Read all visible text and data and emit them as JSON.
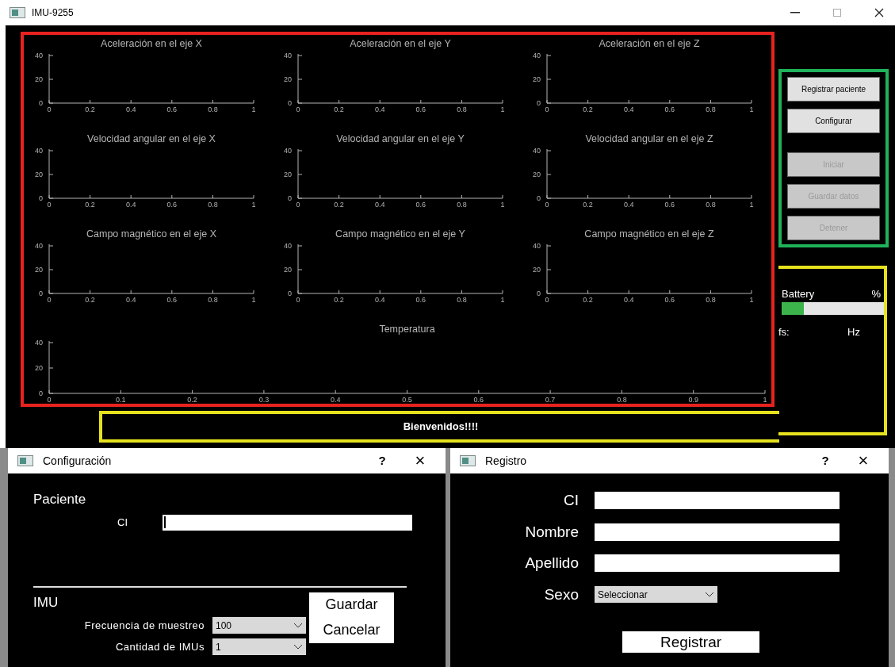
{
  "window": {
    "title": "IMU-9255"
  },
  "charts": [
    {
      "chart_data": {
        "type": "line",
        "title": "Aceleración en el eje X",
        "xlim": [
          0,
          1
        ],
        "ylim": [
          0,
          40
        ],
        "xticks": [
          0,
          0.2,
          0.4,
          0.6,
          0.8,
          1
        ],
        "yticks": [
          0,
          20,
          40
        ]
      }
    },
    {
      "chart_data": {
        "type": "line",
        "title": "Aceleración en el eje Y",
        "xlim": [
          0,
          1
        ],
        "ylim": [
          0,
          40
        ],
        "xticks": [
          0,
          0.2,
          0.4,
          0.6,
          0.8,
          1
        ],
        "yticks": [
          0,
          20,
          40
        ]
      }
    },
    {
      "chart_data": {
        "type": "line",
        "title": "Aceleración en el eje Z",
        "xlim": [
          0,
          1
        ],
        "ylim": [
          0,
          40
        ],
        "xticks": [
          0,
          0.2,
          0.4,
          0.6,
          0.8,
          1
        ],
        "yticks": [
          0,
          20,
          40
        ]
      }
    },
    {
      "chart_data": {
        "type": "line",
        "title": "Velocidad angular en el eje X",
        "xlim": [
          0,
          1
        ],
        "ylim": [
          0,
          40
        ],
        "xticks": [
          0,
          0.2,
          0.4,
          0.6,
          0.8,
          1
        ],
        "yticks": [
          0,
          20,
          40
        ]
      }
    },
    {
      "chart_data": {
        "type": "line",
        "title": "Velocidad angular en el eje Y",
        "xlim": [
          0,
          1
        ],
        "ylim": [
          0,
          40
        ],
        "xticks": [
          0,
          0.2,
          0.4,
          0.6,
          0.8,
          1
        ],
        "yticks": [
          0,
          20,
          40
        ]
      }
    },
    {
      "chart_data": {
        "type": "line",
        "title": "Velocidad angular en el eje Z",
        "xlim": [
          0,
          1
        ],
        "ylim": [
          0,
          40
        ],
        "xticks": [
          0,
          0.2,
          0.4,
          0.6,
          0.8,
          1
        ],
        "yticks": [
          0,
          20,
          40
        ]
      }
    },
    {
      "chart_data": {
        "type": "line",
        "title": "Campo magnético en el eje X",
        "xlim": [
          0,
          1
        ],
        "ylim": [
          0,
          40
        ],
        "xticks": [
          0,
          0.2,
          0.4,
          0.6,
          0.8,
          1
        ],
        "yticks": [
          0,
          20,
          40
        ]
      }
    },
    {
      "chart_data": {
        "type": "line",
        "title": "Campo magnético en el eje Y",
        "xlim": [
          0,
          1
        ],
        "ylim": [
          0,
          40
        ],
        "xticks": [
          0,
          0.2,
          0.4,
          0.6,
          0.8,
          1
        ],
        "yticks": [
          0,
          20,
          40
        ]
      }
    },
    {
      "chart_data": {
        "type": "line",
        "title": "Campo magnético en el eje Z",
        "xlim": [
          0,
          1
        ],
        "ylim": [
          0,
          40
        ],
        "xticks": [
          0,
          0.2,
          0.4,
          0.6,
          0.8,
          1
        ],
        "yticks": [
          0,
          20,
          40
        ]
      }
    },
    {
      "chart_data": {
        "type": "line",
        "title": "Temperatura",
        "xlim": [
          0,
          1
        ],
        "ylim": [
          0,
          40
        ],
        "xticks": [
          0,
          0.1,
          0.2,
          0.3,
          0.4,
          0.5,
          0.6,
          0.7,
          0.8,
          0.9,
          1
        ],
        "yticks": [
          0,
          20,
          40
        ]
      }
    }
  ],
  "controls": [
    {
      "label": "Registrar paciente",
      "disabled": false
    },
    {
      "label": "Configurar",
      "disabled": false
    },
    {
      "label": "Iniciar",
      "disabled": true
    },
    {
      "label": "Guardar datos",
      "disabled": true
    },
    {
      "label": "Detener",
      "disabled": true
    }
  ],
  "status": {
    "battery_label": "Battery",
    "battery_unit": "%",
    "battery": {
      "level": 0.22
    },
    "fs_label": "fs:",
    "fs_unit": "Hz"
  },
  "message": "Bienvenidos!!!!",
  "config_dialog": {
    "title": "Configuración",
    "help": "?",
    "close": "×",
    "patient_heading": "Paciente",
    "ci_label": "CI",
    "ci_focused": true,
    "imu_heading": "IMU",
    "fields": [
      {
        "label": "Frecuencia de muestreo",
        "value": "100"
      },
      {
        "label": "Cantidad de IMUs",
        "value": "1"
      }
    ],
    "buttons": [
      "Guardar",
      "Cancelar"
    ]
  },
  "register_dialog": {
    "title": "Registro",
    "help": "?",
    "close": "×",
    "fields": [
      {
        "label": "CI",
        "kind": "text"
      },
      {
        "label": "Nombre",
        "kind": "text"
      },
      {
        "label": "Apellido",
        "kind": "text"
      },
      {
        "label": "Sexo",
        "kind": "select",
        "value": "Seleccionar"
      }
    ],
    "button": "Registrar"
  }
}
